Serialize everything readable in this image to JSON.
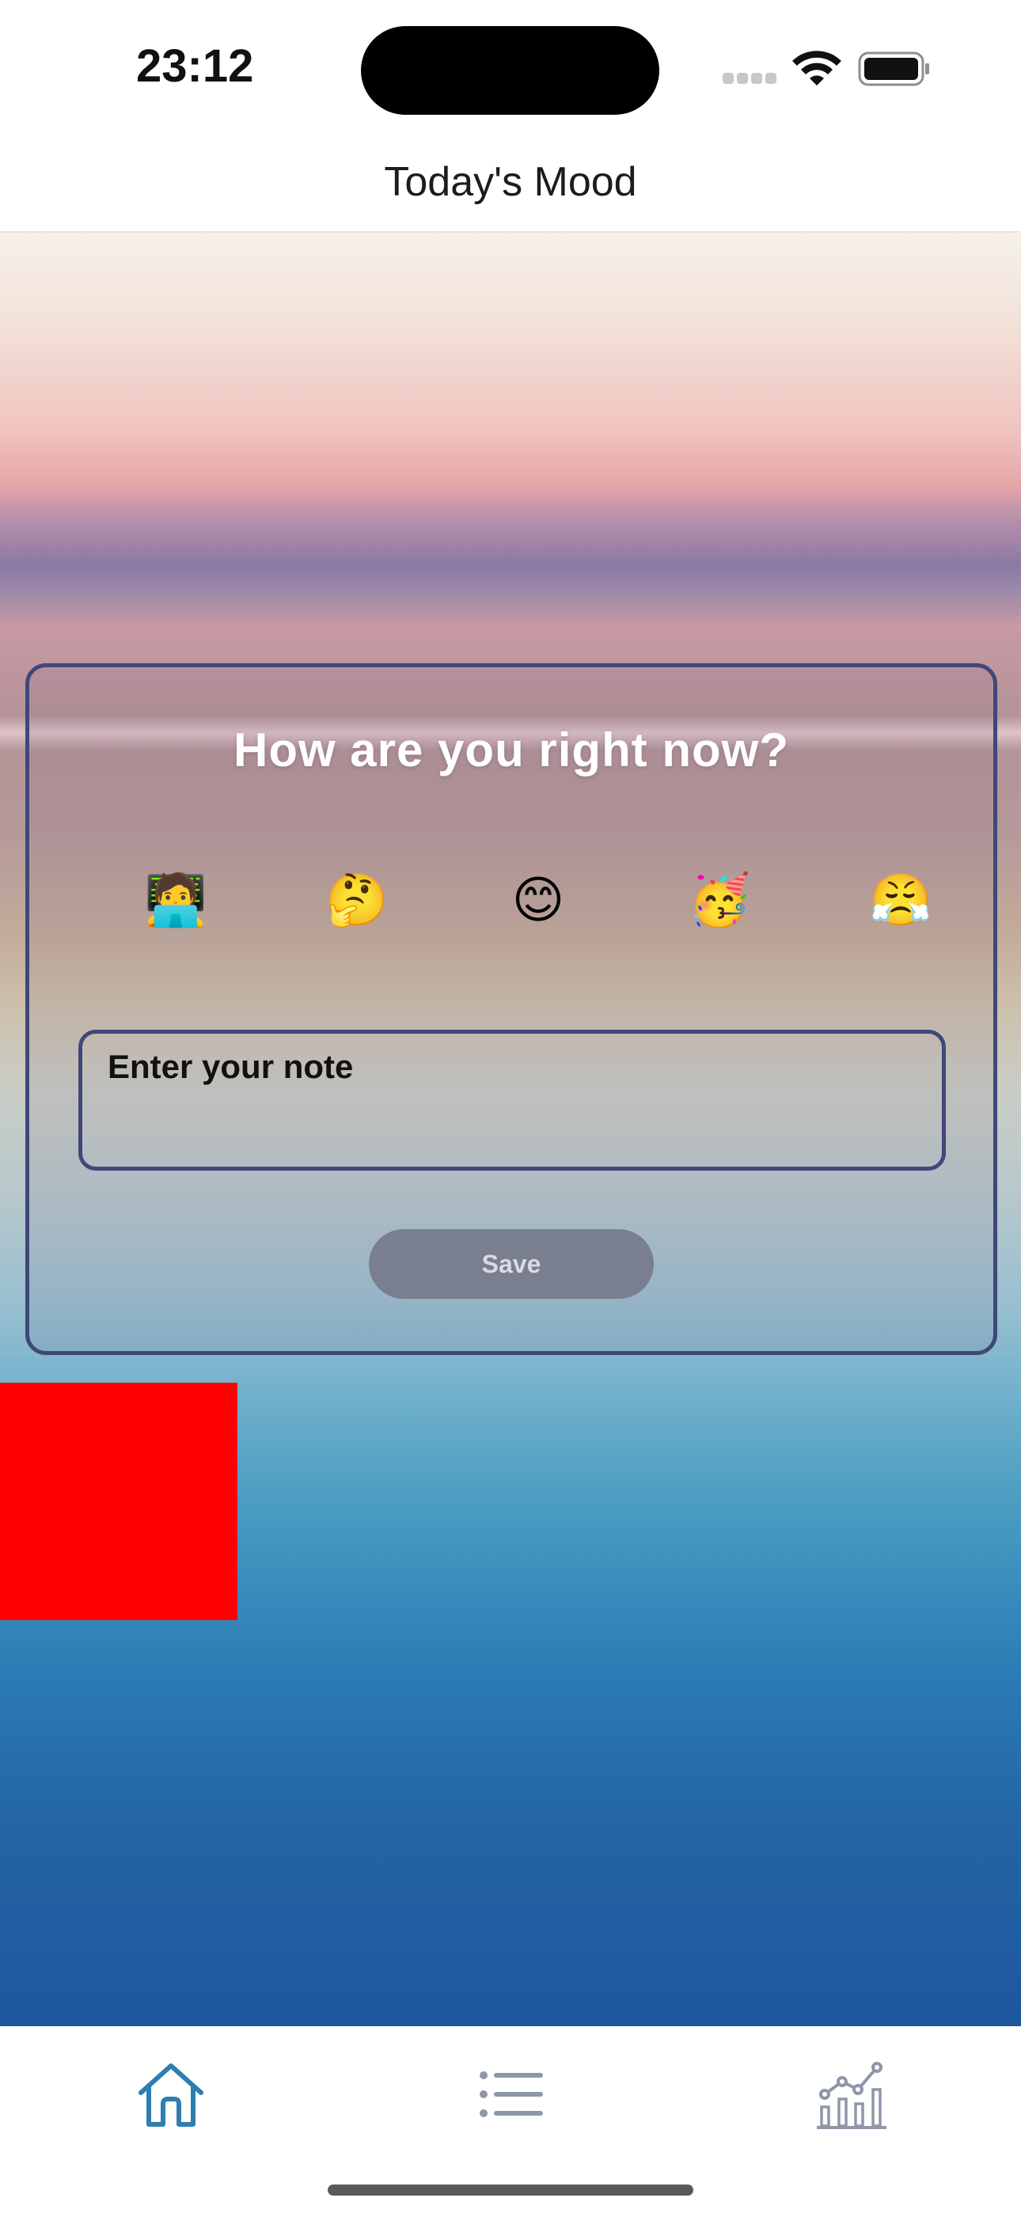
{
  "status_bar": {
    "time": "23:12"
  },
  "nav": {
    "title": "Today's Mood"
  },
  "mood_card": {
    "question": "How are you right now?",
    "emojis": [
      {
        "glyph": "🧑‍💻",
        "icon": "technologist-emoji-icon"
      },
      {
        "glyph": "🤔",
        "icon": "thinking-face-emoji-icon"
      },
      {
        "glyph": "😊",
        "icon": "smiling-face-emoji-icon"
      },
      {
        "glyph": "🥳",
        "icon": "partying-face-emoji-icon"
      },
      {
        "glyph": "😤",
        "icon": "huffing-face-emoji-icon"
      }
    ],
    "note_placeholder": "Enter your note",
    "save_label": "Save"
  },
  "tabs": [
    {
      "icon": "home-icon",
      "active": true
    },
    {
      "icon": "list-icon",
      "active": false
    },
    {
      "icon": "chart-icon",
      "active": false
    }
  ],
  "colors": {
    "accent": "#2e7fae",
    "inactive_tab": "#8d97a8",
    "card_border": "#3f4878",
    "save_button_bg": "#7a7f8f",
    "red_block": "#ff0000"
  }
}
